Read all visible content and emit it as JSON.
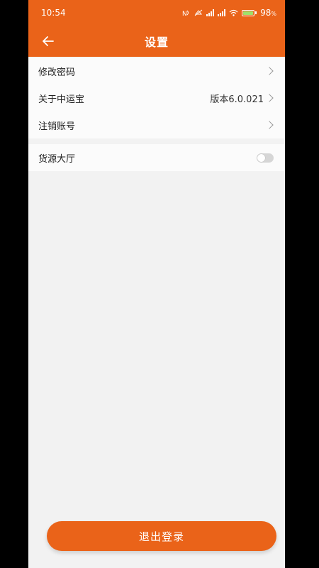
{
  "status_bar": {
    "time": "10:54",
    "battery": "98",
    "battery_unit": "%",
    "icons": [
      "nfc-icon",
      "mute-icon",
      "signal-icon",
      "signal-icon",
      "wifi-icon",
      "battery-icon"
    ]
  },
  "header": {
    "title": "设置",
    "back_icon": "arrow-left-icon",
    "background": "#ea6319"
  },
  "settings": {
    "change_password": "修改密码",
    "about": "关于中运宝",
    "version": "版本6.0.021",
    "deregister": "注销账号",
    "cargo_hall": "货源大厅",
    "cargo_hall_enabled": false
  },
  "logout_button": "退出登录",
  "colors": {
    "accent": "#ea6319",
    "page_background": "#f2f2f2"
  }
}
